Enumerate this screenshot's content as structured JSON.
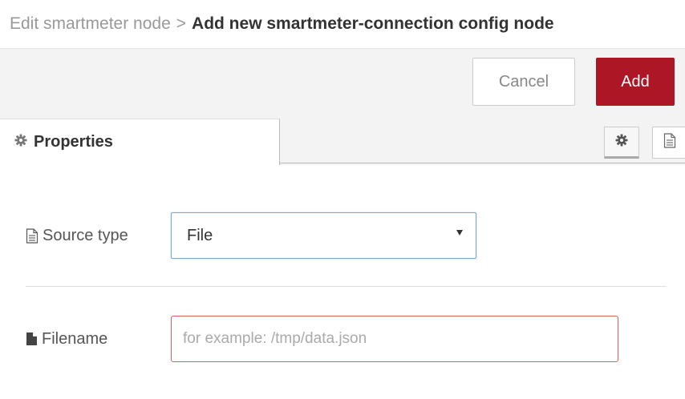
{
  "breadcrumb": {
    "parent": "Edit smartmeter node",
    "separator": ">",
    "current": "Add new smartmeter-connection config node"
  },
  "toolbar": {
    "cancel_label": "Cancel",
    "add_label": "Add"
  },
  "tabs": {
    "properties_label": "Properties",
    "icons": [
      "gear-icon",
      "document-icon"
    ]
  },
  "form": {
    "source_type": {
      "label": "Source type",
      "icon": "document-icon",
      "value": "File"
    },
    "filename": {
      "label": "Filename",
      "icon": "file-icon",
      "value": "",
      "placeholder": "for example: /tmp/data.json"
    }
  },
  "colors": {
    "accent": "#ad1625",
    "error_border": "#d6615e",
    "focus_border": "#7ea6cc"
  }
}
